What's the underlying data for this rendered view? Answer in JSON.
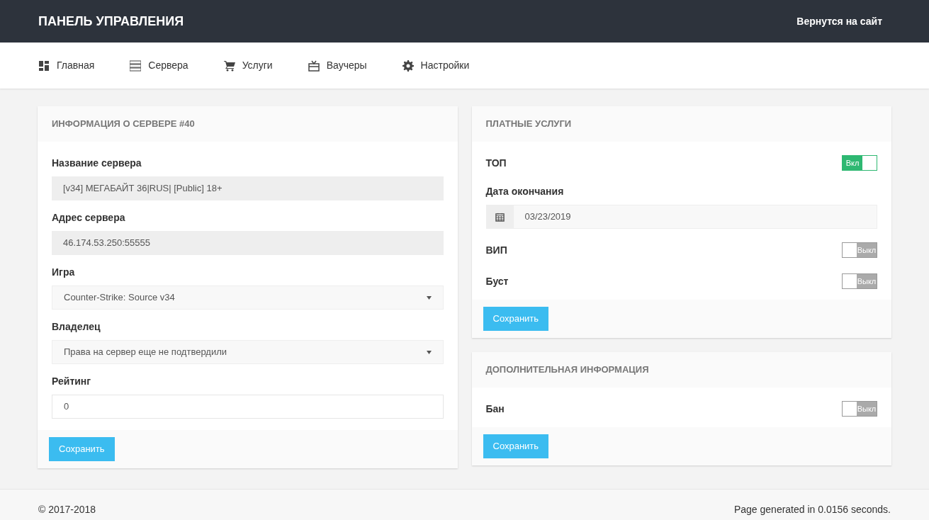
{
  "header": {
    "title": "ПАНЕЛЬ УПРАВЛЕНИЯ",
    "link": "Вернутся на сайт"
  },
  "nav": [
    {
      "label": "Главная"
    },
    {
      "label": "Сервера"
    },
    {
      "label": "Услуги"
    },
    {
      "label": "Ваучеры"
    },
    {
      "label": "Настройки"
    }
  ],
  "server_panel": {
    "title": "ИНФОРМАЦИЯ О СЕРВЕРЕ #40",
    "fields": [
      {
        "label": "Название сервера",
        "kind": "readonly",
        "value": "[v34] МЕГАБАЙТ 36|RUS| [Public] 18+"
      },
      {
        "label": "Адрес сервера",
        "kind": "readonly",
        "value": "46.174.53.250:55555"
      },
      {
        "label": "Игра",
        "kind": "select",
        "value": "Counter-Strike: Source v34"
      },
      {
        "label": "Владелец",
        "kind": "select",
        "value": "Права на сервер еще не подтвердили"
      },
      {
        "label": "Рейтинг",
        "kind": "input",
        "value": "0"
      }
    ],
    "button": "Сохранить"
  },
  "paid_panel": {
    "title": "ПЛАТНЫЕ УСЛУГИ",
    "items": [
      {
        "kind": "toggle",
        "label": "ТОП",
        "on": true,
        "state_text": "Вкл"
      },
      {
        "kind": "date",
        "label": "Дата окончания",
        "value": "03/23/2019"
      },
      {
        "kind": "toggle",
        "label": "ВИП",
        "on": false,
        "state_text": "Выкл"
      },
      {
        "kind": "toggle",
        "label": "Буст",
        "on": false,
        "state_text": "Выкл"
      }
    ],
    "button": "Сохранить"
  },
  "extra_panel": {
    "title": "ДОПОЛНИТЕЛЬНАЯ ИНФОРМАЦИЯ",
    "items": [
      {
        "kind": "toggle",
        "label": "Бан",
        "on": false,
        "state_text": "Выкл"
      }
    ],
    "button": "Сохранить"
  },
  "footer": {
    "copyright": "© 2017-2018",
    "generated": "Page generated in 0.0156 seconds."
  }
}
